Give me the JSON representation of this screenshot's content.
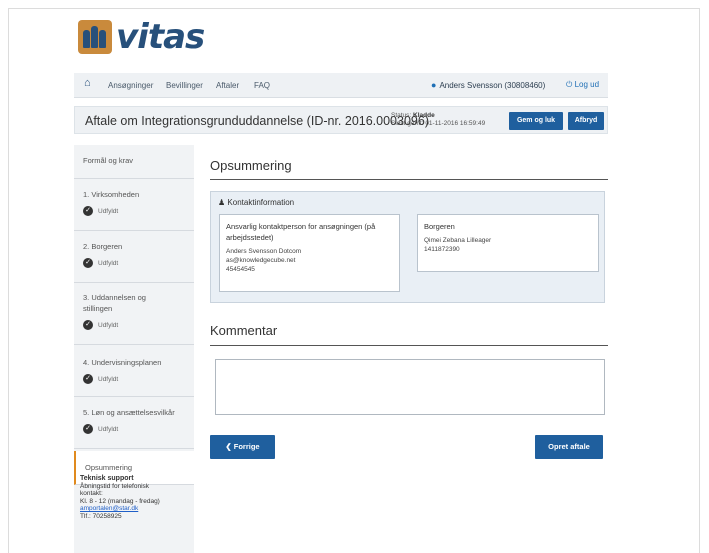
{
  "logo": {
    "text": "vitas"
  },
  "nav": {
    "home_icon": "home-icon",
    "links": [
      "Ansøgninger",
      "Bevillinger",
      "Aftaler",
      "FAQ"
    ],
    "user": "Anders Svensson (30808460)",
    "logout": "Log ud"
  },
  "titlebar": {
    "title": "Aftale om Integrationsgrunduddannelse (ID-nr. 2016.0003096)",
    "status_label": "Status:",
    "status_value": "Kladde",
    "saved": "Sidst gemt: 01-11-2016 16:59:49",
    "save_close": "Gem og luk",
    "cancel": "Afbryd"
  },
  "sidebar": {
    "items": [
      {
        "label": "Formål og krav"
      },
      {
        "label": "1. Virksomheden",
        "status": "Udfyldt"
      },
      {
        "label": "2. Borgeren",
        "status": "Udfyldt"
      },
      {
        "label": "3. Uddannelsen og stillingen",
        "status": "Udfyldt"
      },
      {
        "label": "4. Undervisningsplanen",
        "status": "Udfyldt"
      },
      {
        "label": "5. Løn og ansættelsesvilkår",
        "status": "Udfyldt"
      },
      {
        "label": "Opsummering"
      }
    ]
  },
  "support": {
    "title": "Teknisk support",
    "line1": "Åbningstid for telefonisk",
    "line2": "kontakt:",
    "line3": "Kl. 8 - 12 (mandag - fredag)",
    "email": "amportalen@star.dk",
    "phone": "Tlf.: 70258925"
  },
  "main": {
    "heading": "Opsummering",
    "contact_section": "Kontaktinformation",
    "contact_card": {
      "title": "Ansvarlig kontaktperson for ansøgningen (på arbejdsstedet)",
      "name": "Anders Svensson Dotcom",
      "email": "as@knowledgecube.net",
      "phone": "45454545"
    },
    "citizen_card": {
      "title": "Borgeren",
      "name": "Qimei Zebana Lilleager",
      "cpr": "1411872390"
    },
    "comment_heading": "Kommentar",
    "comment_value": "",
    "prev_button": "Forrige",
    "create_button": "Opret aftale"
  },
  "colors": {
    "primary": "#1f5f9e",
    "brand": "#27507b",
    "accent": "#e08a1e"
  }
}
